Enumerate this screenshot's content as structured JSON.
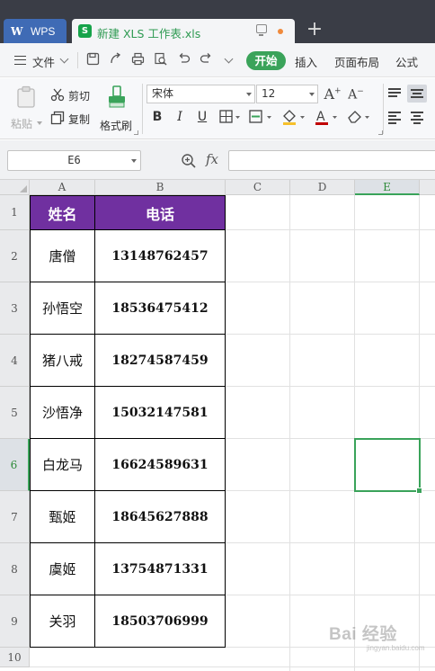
{
  "titlebar": {
    "app_tab_label": "WPS",
    "doc_tab_title": "新建 XLS 工作表.xls",
    "new_tab": "+"
  },
  "menu": {
    "file": "文件",
    "start": "开始",
    "insert": "插入",
    "page_layout": "页面布局",
    "formulas": "公式"
  },
  "ribbon": {
    "paste": "粘贴",
    "cut": "剪切",
    "copy": "复制",
    "format_painter": "格式刷",
    "font_name": "宋体",
    "font_size": "12"
  },
  "formula_bar": {
    "name_box": "E6",
    "fx": "fx",
    "formula": ""
  },
  "sheet": {
    "columns": [
      "A",
      "B",
      "C",
      "D",
      "E"
    ],
    "rows": [
      "1",
      "2",
      "3",
      "4",
      "5",
      "6",
      "7",
      "8",
      "9",
      "10"
    ],
    "active_column": "E",
    "active_row": "6",
    "table_header": [
      "姓名",
      "电话"
    ],
    "records": [
      {
        "name": "唐僧",
        "phone": "13148762457"
      },
      {
        "name": "孙悟空",
        "phone": "18536475412"
      },
      {
        "name": "猪八戒",
        "phone": "18274587459"
      },
      {
        "name": "沙悟净",
        "phone": "15032147581"
      },
      {
        "name": "白龙马",
        "phone": "16624589631"
      },
      {
        "name": "甄姬",
        "phone": "18645627888"
      },
      {
        "name": "虞姬",
        "phone": "13754871331"
      },
      {
        "name": "关羽",
        "phone": "18503706999"
      }
    ]
  },
  "colors": {
    "header_fill": "#7030a0",
    "accent": "#3aa35a",
    "titlebar": "#3a3d46"
  },
  "watermark": {
    "text": "Bai 经验",
    "sub": "jingyan.baidu.com"
  }
}
